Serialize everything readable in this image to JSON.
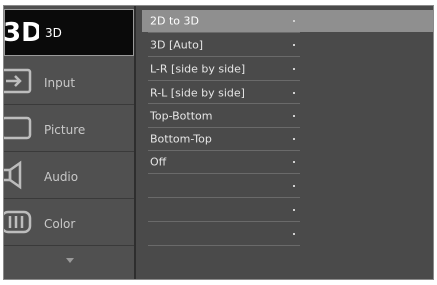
{
  "nav": {
    "items": [
      {
        "label": "3D",
        "icon": "3d-icon"
      },
      {
        "label": "Input",
        "icon": "input-icon"
      },
      {
        "label": "Picture",
        "icon": "picture-icon"
      },
      {
        "label": "Audio",
        "icon": "audio-icon"
      },
      {
        "label": "Color",
        "icon": "color-icon"
      }
    ],
    "active_index": 0
  },
  "submenu": {
    "options": [
      {
        "label": "2D to 3D"
      },
      {
        "label": "3D [Auto]"
      },
      {
        "label": "L-R [side by side]"
      },
      {
        "label": "R-L [side by side]"
      },
      {
        "label": "Top-Bottom"
      },
      {
        "label": "Bottom-Top"
      },
      {
        "label": "Off"
      },
      {
        "label": ""
      },
      {
        "label": ""
      },
      {
        "label": ""
      }
    ],
    "selected_index": 0
  },
  "colors": {
    "panel": "#4a4a4a",
    "active_nav": "#0a0a0a",
    "selected_option": "#8f8f8f"
  }
}
